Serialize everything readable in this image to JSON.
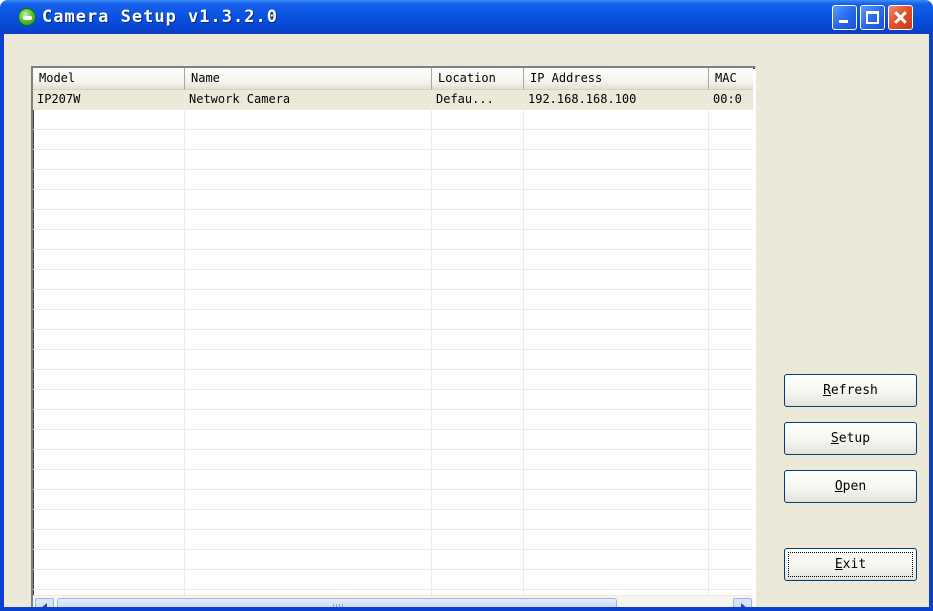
{
  "window": {
    "title": "Camera Setup v1.3.2.0",
    "icon": "camera-app-icon",
    "controls": [
      "minimize-icon",
      "maximize-icon",
      "close-icon"
    ]
  },
  "list": {
    "columns": [
      "Model",
      "Name",
      "Location",
      "IP Address",
      "MAC"
    ],
    "rows": [
      {
        "model": "IP207W",
        "name": "Network Camera",
        "location": "Defau...",
        "ip": "192.168.168.100",
        "mac": "00:0"
      }
    ]
  },
  "buttons": {
    "refresh": {
      "accel": "R",
      "rest": "efresh"
    },
    "setup": {
      "accel": "S",
      "rest": "etup"
    },
    "open": {
      "accel": "O",
      "rest": "pen"
    },
    "exit": {
      "accel": "E",
      "rest": "xit"
    }
  },
  "colors": {
    "titlebar": "#0a54e3",
    "client": "#ece9d8",
    "button_border": "#003c74"
  }
}
